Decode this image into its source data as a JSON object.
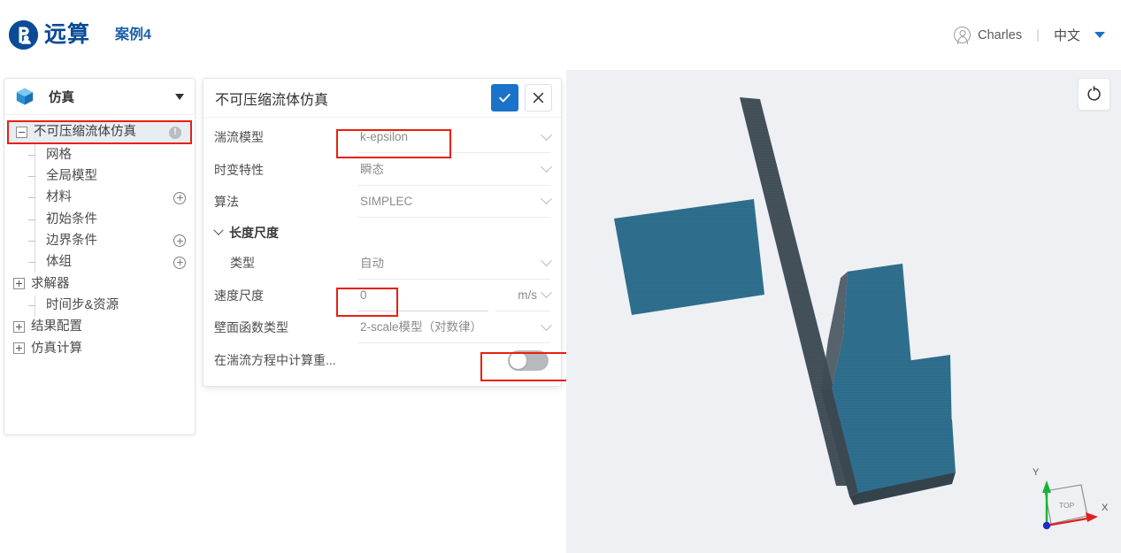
{
  "app": {
    "brand_name": "远算",
    "case_name": "案例4",
    "logo_icon": "company-logo-b-circle"
  },
  "topbar": {
    "user_name": "Charles",
    "user_icon": "user-avatar-icon",
    "separator": "|",
    "language": "中文",
    "language_caret_icon": "caret-down-icon"
  },
  "sidebar": {
    "header": {
      "title": "仿真",
      "icon": "cube-icon",
      "caret_icon": "caret-down-icon"
    },
    "tree": [
      {
        "label": "不可压缩流体仿真",
        "level": 0,
        "marker": "minus-box",
        "selected": true,
        "badge": "!",
        "badge_icon": "warning-circle-icon",
        "highlighted": true
      },
      {
        "label": "网格",
        "level": 1,
        "marker": "dash",
        "selected": false,
        "badge": null,
        "badge_icon": null
      },
      {
        "label": "全局模型",
        "level": 1,
        "marker": "dash",
        "selected": false,
        "badge": null,
        "badge_icon": null
      },
      {
        "label": "材料",
        "level": 1,
        "marker": "dash",
        "selected": false,
        "badge": null,
        "badge_icon": "plus-circle-icon"
      },
      {
        "label": "初始条件",
        "level": 1,
        "marker": "dash",
        "selected": false,
        "badge": null,
        "badge_icon": null
      },
      {
        "label": "边界条件",
        "level": 1,
        "marker": "dash",
        "selected": false,
        "badge": null,
        "badge_icon": "plus-circle-icon"
      },
      {
        "label": "体组",
        "level": 1,
        "marker": "dash",
        "selected": false,
        "badge": null,
        "badge_icon": "plus-circle-icon"
      },
      {
        "label": "求解器",
        "level": 0,
        "marker": "plus-box",
        "selected": false,
        "badge": null,
        "badge_icon": null
      },
      {
        "label": "时间步&资源",
        "level": 1,
        "marker": "dash",
        "selected": false,
        "badge": null,
        "badge_icon": null
      },
      {
        "label": "结果配置",
        "level": 0,
        "marker": "plus-box",
        "selected": false,
        "badge": null,
        "badge_icon": null
      },
      {
        "label": "仿真计算",
        "level": 0,
        "marker": "plus-box",
        "selected": false,
        "badge": null,
        "badge_icon": null
      }
    ]
  },
  "dialog": {
    "title": "不可压缩流体仿真",
    "confirm_icon": "check-icon",
    "cancel_icon": "close-icon",
    "rows": {
      "turbulence_model": {
        "label": "湍流模型",
        "value": "k-epsilon",
        "chevron_icon": "chevron-down-icon",
        "highlighted": true
      },
      "time_dependency": {
        "label": "时变特性",
        "value": "瞬态",
        "chevron_icon": "chevron-down-icon"
      },
      "algorithm": {
        "label": "算法",
        "value": "SIMPLEC",
        "chevron_icon": "chevron-down-icon"
      },
      "length_scale_section": {
        "label": "长度尺度",
        "chevron_icon": "chevron-down-icon"
      },
      "length_type": {
        "label": "类型",
        "value": "自动",
        "chevron_icon": "chevron-down-icon"
      },
      "velocity_scale": {
        "label": "速度尺度",
        "value": "0",
        "unit": "m/s",
        "chevron_icon": "chevron-down-icon",
        "highlighted": true
      },
      "wall_function": {
        "label": "壁面函数类型",
        "value": "2-scale模型（对数律）",
        "chevron_icon": "chevron-down-icon"
      },
      "gravity_in_turb": {
        "label": "在湍流方程中计算重...",
        "toggle_state": "off",
        "highlighted": true
      }
    }
  },
  "viewport": {
    "reset_view_icon": "rotate-reset-icon",
    "axis_triad": {
      "face_label": "TOP",
      "axis_x_label": "X",
      "axis_y_label": "Y",
      "color_x": "#e02020",
      "color_y": "#18b334",
      "color_origin": "#1a2fc8"
    },
    "model": {
      "mesh_color": "#2d6d8b",
      "mesh_shadow_color": "#44525c",
      "background_color": "#eef0f4"
    }
  },
  "annotations": {
    "highlight_color": "#e8200f"
  }
}
